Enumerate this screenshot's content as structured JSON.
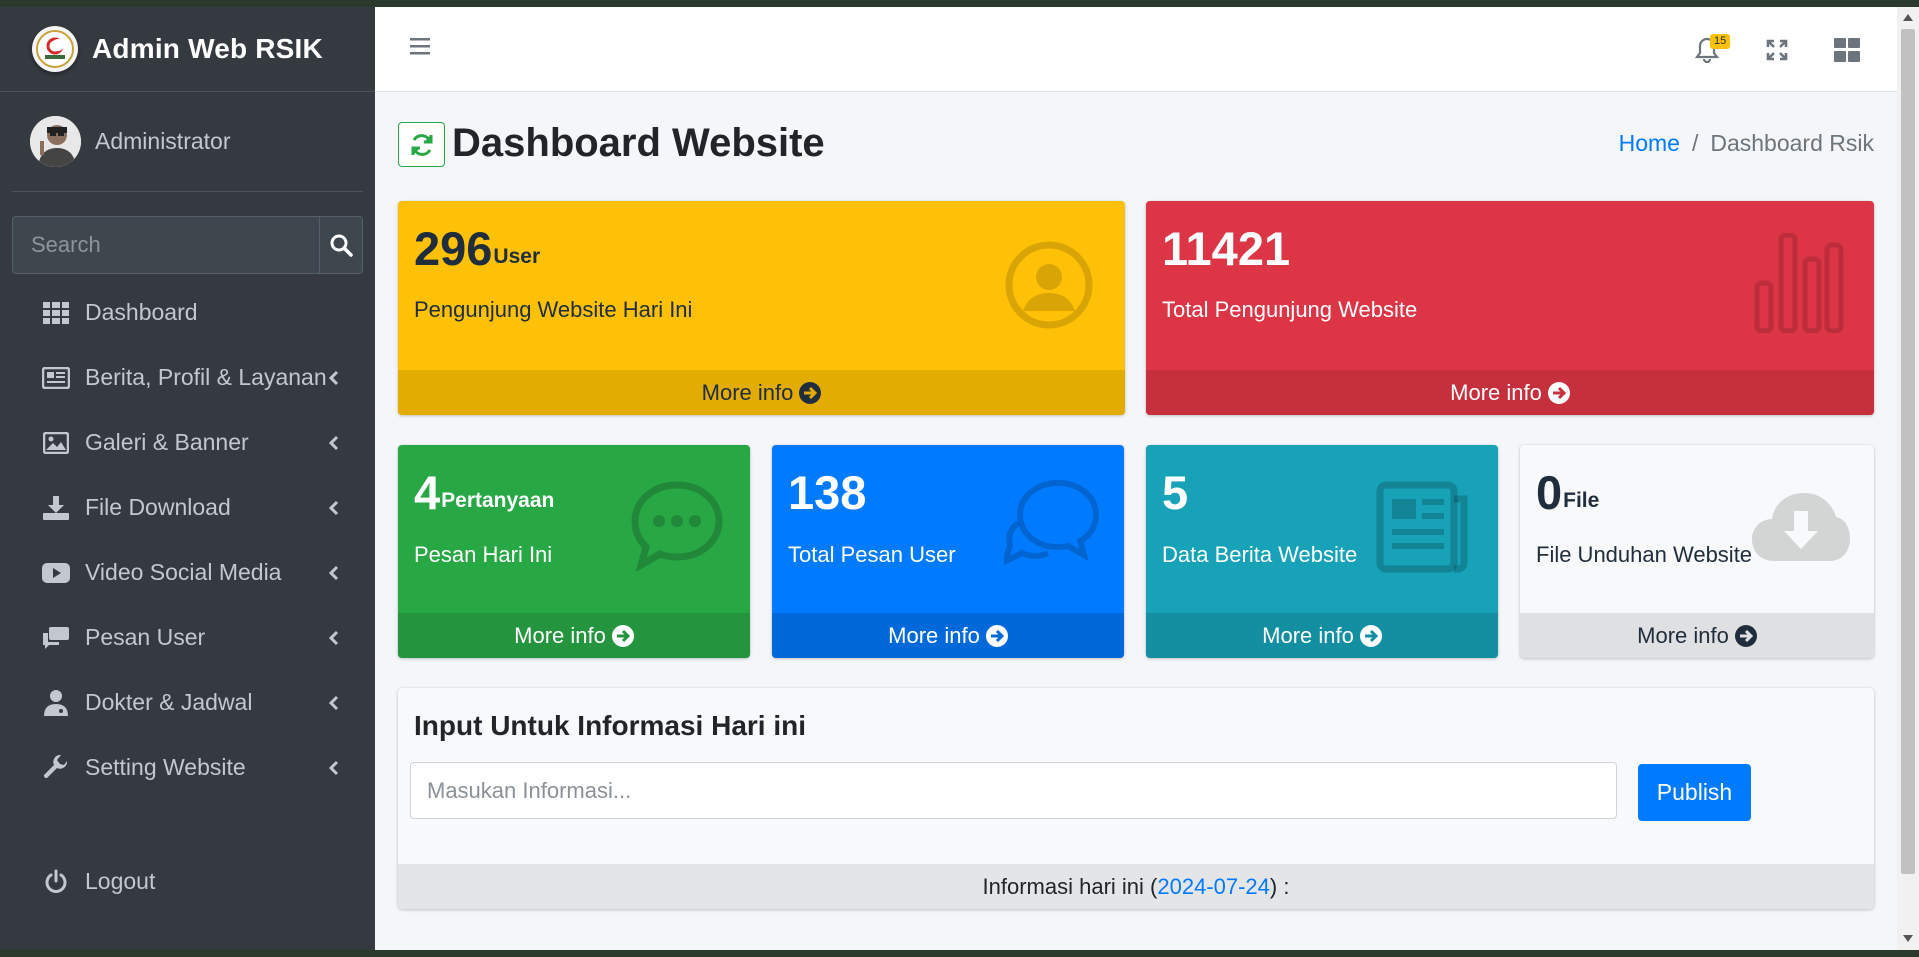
{
  "brand": {
    "title": "Admin Web RSIK"
  },
  "user": {
    "name": "Administrator"
  },
  "sidebar_search": {
    "placeholder": "Search"
  },
  "sidebar": {
    "items": [
      {
        "label": "Dashboard",
        "icon": "grid-icon"
      },
      {
        "label": "Berita, Profil & Layanan",
        "icon": "newspaper-icon"
      },
      {
        "label": "Galeri & Banner",
        "icon": "image-icon"
      },
      {
        "label": "File Download",
        "icon": "download-icon"
      },
      {
        "label": "Video Social Media",
        "icon": "video-icon"
      },
      {
        "label": "Pesan User",
        "icon": "comments-icon"
      },
      {
        "label": "Dokter & Jadwal",
        "icon": "doctor-icon"
      },
      {
        "label": "Setting Website",
        "icon": "wrench-icon"
      }
    ],
    "logout": "Logout"
  },
  "navbar": {
    "notification_count": "15"
  },
  "header": {
    "title": "Dashboard Website",
    "breadcrumb_home": "Home",
    "breadcrumb_separator": "/",
    "breadcrumb_current": "Dashboard Rsik"
  },
  "stats": [
    {
      "value": "296",
      "unit": "User",
      "label": "Pengunjung Website Hari Ini",
      "more": "More info",
      "color": "#ffc107",
      "icon": "user-circle-icon"
    },
    {
      "value": "11421",
      "unit": "",
      "label": "Total Pengunjung Website",
      "more": "More info",
      "color": "#dc3545",
      "icon": "bar-chart-icon"
    },
    {
      "value": "4",
      "unit": "Pertanyaan",
      "label": "Pesan Hari Ini",
      "more": "More info",
      "color": "#28a745",
      "icon": "comment-dots-icon"
    },
    {
      "value": "138",
      "unit": "",
      "label": "Total Pesan User",
      "more": "More info",
      "color": "#007bff",
      "icon": "comments-outline-icon"
    },
    {
      "value": "5",
      "unit": "",
      "label": "Data Berita Website",
      "more": "More info",
      "color": "#17a2b8",
      "icon": "newspaper-icon"
    },
    {
      "value": "0",
      "unit": "File",
      "label": "File Unduhan Website",
      "more": "More info",
      "color": "#f8f9fa",
      "icon": "cloud-download-icon"
    }
  ],
  "info_panel": {
    "title": "Input Untuk Informasi Hari ini",
    "placeholder": "Masukan Informasi...",
    "publish": "Publish",
    "footer_prefix": "Informasi hari ini (",
    "footer_date": "2024-07-24",
    "footer_suffix": ") :"
  }
}
